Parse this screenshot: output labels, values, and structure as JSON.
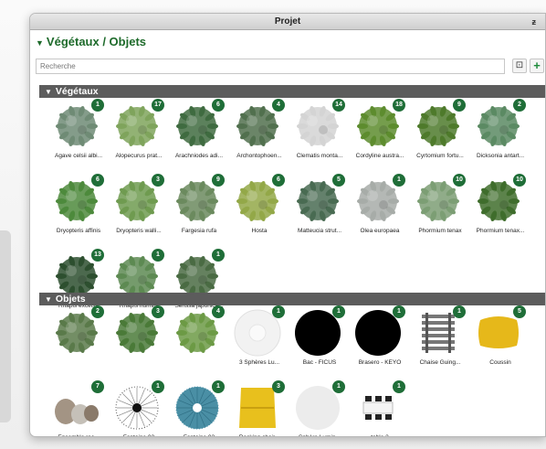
{
  "window": {
    "title": "Projet",
    "pin_glyph": "ᵶ"
  },
  "panel": {
    "title": "Végétaux / Objets",
    "collapse_glyph": "▼"
  },
  "search": {
    "placeholder": "Recherche"
  },
  "toolbar": {
    "view_glyph": "⊡",
    "add_glyph": "+",
    "grid_glyph": "■"
  },
  "sections": {
    "plants": {
      "title": "Végétaux",
      "collapse_glyph": "▼",
      "items": [
        {
          "label": "Agave celsii albi...",
          "count": "1",
          "icon": "agave-icon",
          "color": "#6f8b75"
        },
        {
          "label": "Alopecurus prat...",
          "count": "17",
          "icon": "grass-icon",
          "color": "#7fa45c"
        },
        {
          "label": "Arachniodes adi...",
          "count": "6",
          "icon": "fern-icon",
          "color": "#3f6b40"
        },
        {
          "label": "Archontophoen...",
          "count": "4",
          "icon": "palm-icon",
          "color": "#51704e"
        },
        {
          "label": "Clematis monta...",
          "count": "14",
          "icon": "flowering-plant-icon",
          "color": "#d4d4d4"
        },
        {
          "label": "Cordyline austra...",
          "count": "18",
          "icon": "cordyline-icon",
          "color": "#5d8c2e"
        },
        {
          "label": "Cyrtomium fortu...",
          "count": "9",
          "icon": "fern-icon",
          "color": "#4e7a2b"
        },
        {
          "label": "Dicksonia antart...",
          "count": "2",
          "icon": "tree-fern-icon",
          "color": "#5b8a63"
        },
        {
          "label": "Dryopteris affinis",
          "count": "6",
          "icon": "fern-icon",
          "color": "#4d8a3c"
        },
        {
          "label": "Dryopteris walli...",
          "count": "3",
          "icon": "fern-icon",
          "color": "#6f9b50"
        },
        {
          "label": "Fargesia rufa",
          "count": "9",
          "icon": "bamboo-icon",
          "color": "#6b8a5e"
        },
        {
          "label": "Hosta",
          "count": "6",
          "icon": "hosta-icon",
          "color": "#93a848"
        },
        {
          "label": "Matteucia strut...",
          "count": "5",
          "icon": "fern-icon",
          "color": "#496b52"
        },
        {
          "label": "Olea europaea",
          "count": "1",
          "icon": "olive-tree-icon",
          "color": "#a7aca8"
        },
        {
          "label": "Phormium tenax",
          "count": "10",
          "icon": "phormium-icon",
          "color": "#7c9e74"
        },
        {
          "label": "Phormium tenax...",
          "count": "10",
          "icon": "phormium-icon",
          "color": "#3f6d2c"
        },
        {
          "label": "Rhapis excelsa",
          "count": "13",
          "icon": "palm-icon",
          "color": "#2d4f2f"
        },
        {
          "label": "Rhapis humilis",
          "count": "1",
          "icon": "palm-icon",
          "color": "#5d8a52"
        },
        {
          "label": "Serissa japonica...",
          "count": "1",
          "icon": "shrub-icon",
          "color": "#4a6b43"
        }
      ]
    },
    "objects": {
      "title": "Objets",
      "collapse_glyph": "▼",
      "items": [
        {
          "label": "",
          "count": "2",
          "icon": "hedge-icon",
          "color": "#5a7a4a"
        },
        {
          "label": "",
          "count": "3",
          "icon": "shrub-icon",
          "color": "#4a7a38"
        },
        {
          "label": "",
          "count": "4",
          "icon": "palm-icon",
          "color": "#6c9a45"
        },
        {
          "label": "3 Sphères Lu...",
          "count": "1",
          "icon": "spheres-icon",
          "color": "#e4e4e4"
        },
        {
          "label": "Bac - FICUS",
          "count": "1",
          "icon": "ficus-pot-icon",
          "color": "#000000"
        },
        {
          "label": "Brasero - KEYO",
          "count": "1",
          "icon": "brasero-icon",
          "color": "#000000"
        },
        {
          "label": "Chaise Guing...",
          "count": "1",
          "icon": "chair-icon",
          "color": "#777777"
        },
        {
          "label": "Coussin",
          "count": "5",
          "icon": "cushion-icon",
          "color": "#e6b81a"
        },
        {
          "label": "Ensemble roc...",
          "count": "7",
          "icon": "rocks-icon",
          "color": "#9a8a7a"
        },
        {
          "label": "Fontaine 02",
          "count": "1",
          "icon": "fountain-icon",
          "color": "#555555"
        },
        {
          "label": "Fontaine 03",
          "count": "1",
          "icon": "fountain-icon",
          "color": "#4a8fa5"
        },
        {
          "label": "Rocking chair...",
          "count": "3",
          "icon": "rocking-chair-icon",
          "color": "#e8c01d"
        },
        {
          "label": "Sphère Lumin...",
          "count": "1",
          "icon": "light-sphere-icon",
          "color": "#e8e8e8"
        },
        {
          "label": "table 3",
          "count": "1",
          "icon": "table-icon",
          "color": "#222222"
        }
      ]
    }
  }
}
